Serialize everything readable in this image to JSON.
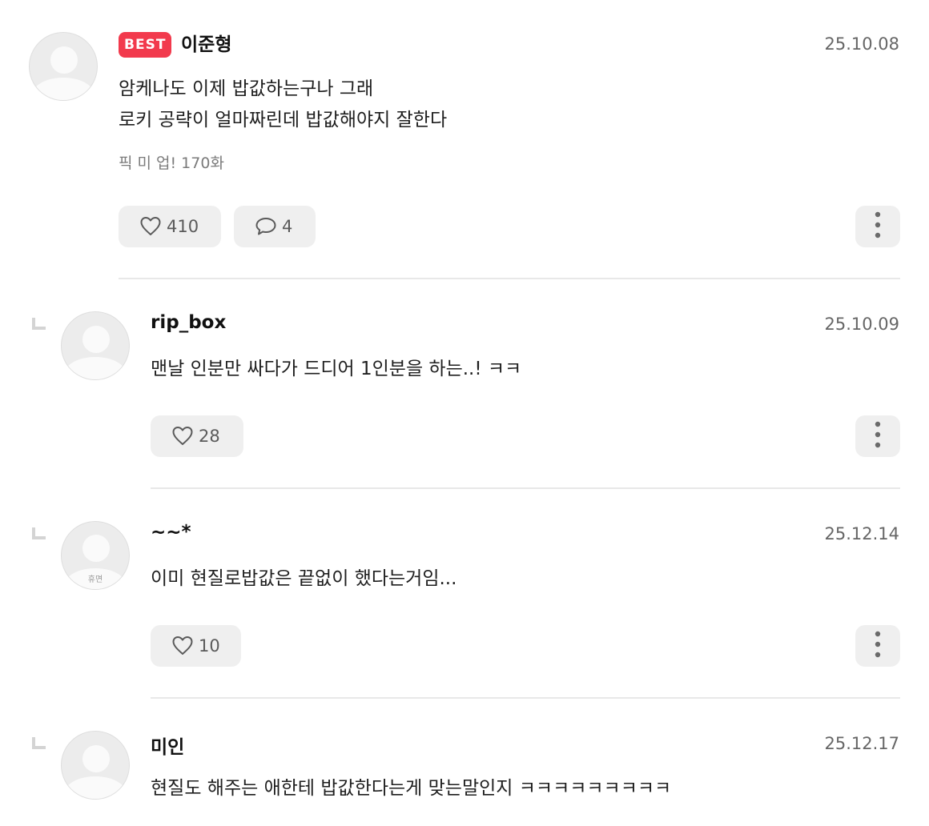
{
  "comments": [
    {
      "badge": "BEST",
      "username": "이준형",
      "date": "25.10.08",
      "lines": [
        "암케나도 이제 밥값하는구나 그래",
        "로키 공략이 얼마짜린데 밥값해야지 잘한다"
      ],
      "episode": "픽 미 업! 170화",
      "likes": "410",
      "replies": "4"
    },
    {
      "username": "rip_box",
      "date": "25.10.09",
      "lines": [
        "맨날 인분만 싸다가 드디어 1인분을 하는..! ㅋㅋ"
      ],
      "likes": "28"
    },
    {
      "username": "~~*",
      "date": "25.12.14",
      "avatar_label": "휴면",
      "lines": [
        "이미 현질로밥값은 끝없이 했다는거임..."
      ],
      "likes": "10"
    },
    {
      "username": "미인",
      "date": "25.12.17",
      "lines": [
        "현질도 해주는 애한테 밥값한다는게 맞는말인지 ㅋㅋㅋㅋㅋㅋㅋㅋㅋ"
      ]
    }
  ],
  "icons": {
    "like": "heart-icon",
    "reply": "speech-bubble-icon",
    "more": "vertical-ellipsis-icon",
    "reply_indicator": "reply-corner-icon"
  },
  "colors": {
    "best_badge": "#f23a4d",
    "pill_bg": "#efefef",
    "divider": "#e8e8e8"
  }
}
